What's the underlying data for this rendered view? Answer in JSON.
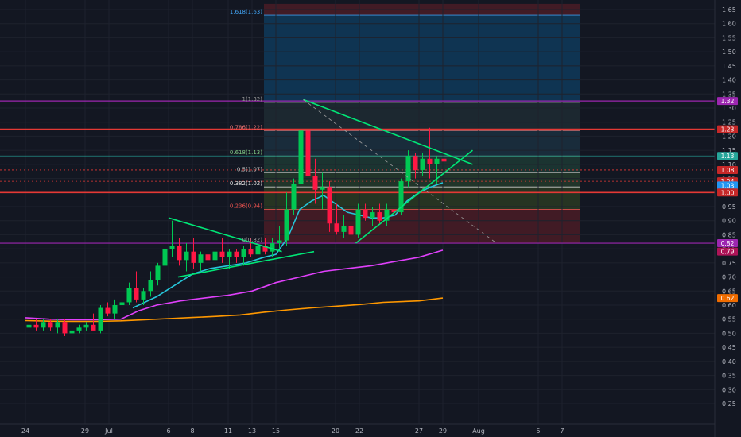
{
  "chart_data": {
    "type": "candlestick",
    "price_axis": {
      "min": 0.2,
      "max": 1.67,
      "ticks": [
        "1.65",
        "1.60",
        "1.55",
        "1.50",
        "1.45",
        "1.40",
        "1.35",
        "1.30",
        "1.25",
        "1.20",
        "1.15",
        "1.10",
        "1.05",
        "1.00",
        "0.95",
        "0.90",
        "0.85",
        "0.80",
        "0.75",
        "0.70",
        "0.65",
        "0.60",
        "0.55",
        "0.50",
        "0.45",
        "0.40",
        "0.35",
        "0.30",
        "0.25"
      ]
    },
    "time_axis": {
      "ticks": [
        {
          "label": "24",
          "day": 0
        },
        {
          "label": "29",
          "day": 5
        },
        {
          "label": "Jul",
          "day": 7
        },
        {
          "label": "6",
          "day": 12
        },
        {
          "label": "8",
          "day": 14
        },
        {
          "label": "11",
          "day": 17
        },
        {
          "label": "13",
          "day": 19
        },
        {
          "label": "15",
          "day": 21
        },
        {
          "label": "20",
          "day": 26
        },
        {
          "label": "22",
          "day": 28
        },
        {
          "label": "27",
          "day": 33
        },
        {
          "label": "29",
          "day": 35
        },
        {
          "label": "Aug",
          "day": 38
        },
        {
          "label": "5",
          "day": 43
        },
        {
          "label": "7",
          "day": 45
        }
      ]
    },
    "price_tags": [
      {
        "label": "1.32",
        "price": 1.325,
        "color": "#9c27b0"
      },
      {
        "label": "1.23",
        "price": 1.225,
        "color": "#c62828"
      },
      {
        "label": "1.13",
        "price": 1.13,
        "color": "#26a69a"
      },
      {
        "label": "1.08",
        "price": 1.08,
        "color": "#c62828"
      },
      {
        "label": "1.04",
        "price": 1.04,
        "color": "#c62828"
      },
      {
        "label": "1.03",
        "price": 1.025,
        "color": "#2196f3"
      },
      {
        "label": "1.00",
        "price": 1.0,
        "color": "#c62828"
      },
      {
        "label": "0.82",
        "price": 0.82,
        "color": "#9c27b0"
      },
      {
        "label": "0.79",
        "price": 0.79,
        "color": "#ad1457"
      },
      {
        "label": "0.62",
        "price": 0.625,
        "color": "#ef6c00"
      }
    ],
    "fib_levels": [
      {
        "label": "1.618(1.63)",
        "price": 1.63,
        "color": "#42a5f5"
      },
      {
        "label": "1(1.32)",
        "price": 1.32,
        "color": "#9e9e9e"
      },
      {
        "label": "0.786(1.22)",
        "price": 1.22,
        "color": "#e57373"
      },
      {
        "label": "0.618(1.13)",
        "price": 1.13,
        "color": "#81c784"
      },
      {
        "label": "0.5(1.07)",
        "price": 1.07,
        "color": "#c0c0c0"
      },
      {
        "label": "0.382(1.02)",
        "price": 1.02,
        "color": "#e0e0e0"
      },
      {
        "label": "0.236(0.94)",
        "price": 0.94,
        "color": "#ef5350"
      },
      {
        "label": "0(0.82)",
        "price": 0.82,
        "color": "#9e9e9e"
      }
    ],
    "candles": [
      {
        "d": 0.3,
        "o": 0.52,
        "h": 0.54,
        "l": 0.51,
        "c": 0.53
      },
      {
        "d": 0.9,
        "o": 0.53,
        "h": 0.55,
        "l": 0.51,
        "c": 0.52
      },
      {
        "d": 1.5,
        "o": 0.52,
        "h": 0.55,
        "l": 0.51,
        "c": 0.54
      },
      {
        "d": 2.1,
        "o": 0.54,
        "h": 0.55,
        "l": 0.51,
        "c": 0.52
      },
      {
        "d": 2.7,
        "o": 0.52,
        "h": 0.55,
        "l": 0.5,
        "c": 0.54
      },
      {
        "d": 3.3,
        "o": 0.54,
        "h": 0.55,
        "l": 0.49,
        "c": 0.5
      },
      {
        "d": 3.9,
        "o": 0.5,
        "h": 0.52,
        "l": 0.49,
        "c": 0.51
      },
      {
        "d": 4.5,
        "o": 0.51,
        "h": 0.53,
        "l": 0.5,
        "c": 0.52
      },
      {
        "d": 5.1,
        "o": 0.52,
        "h": 0.54,
        "l": 0.51,
        "c": 0.53
      },
      {
        "d": 5.7,
        "o": 0.53,
        "h": 0.57,
        "l": 0.52,
        "c": 0.51
      },
      {
        "d": 6.3,
        "o": 0.51,
        "h": 0.6,
        "l": 0.5,
        "c": 0.59
      },
      {
        "d": 6.9,
        "o": 0.59,
        "h": 0.61,
        "l": 0.56,
        "c": 0.57
      },
      {
        "d": 7.5,
        "o": 0.57,
        "h": 0.62,
        "l": 0.55,
        "c": 0.6
      },
      {
        "d": 8.1,
        "o": 0.6,
        "h": 0.65,
        "l": 0.58,
        "c": 0.61
      },
      {
        "d": 8.7,
        "o": 0.61,
        "h": 0.68,
        "l": 0.6,
        "c": 0.66
      },
      {
        "d": 9.3,
        "o": 0.66,
        "h": 0.72,
        "l": 0.61,
        "c": 0.62
      },
      {
        "d": 9.9,
        "o": 0.62,
        "h": 0.66,
        "l": 0.6,
        "c": 0.65
      },
      {
        "d": 10.5,
        "o": 0.65,
        "h": 0.72,
        "l": 0.63,
        "c": 0.69
      },
      {
        "d": 11.1,
        "o": 0.69,
        "h": 0.75,
        "l": 0.67,
        "c": 0.74
      },
      {
        "d": 11.7,
        "o": 0.74,
        "h": 0.83,
        "l": 0.72,
        "c": 0.8
      },
      {
        "d": 12.3,
        "o": 0.8,
        "h": 0.9,
        "l": 0.77,
        "c": 0.81
      },
      {
        "d": 12.9,
        "o": 0.81,
        "h": 0.84,
        "l": 0.74,
        "c": 0.76
      },
      {
        "d": 13.5,
        "o": 0.76,
        "h": 0.82,
        "l": 0.72,
        "c": 0.79
      },
      {
        "d": 14.1,
        "o": 0.79,
        "h": 0.84,
        "l": 0.73,
        "c": 0.75
      },
      {
        "d": 14.7,
        "o": 0.75,
        "h": 0.79,
        "l": 0.72,
        "c": 0.78
      },
      {
        "d": 15.3,
        "o": 0.78,
        "h": 0.8,
        "l": 0.74,
        "c": 0.76
      },
      {
        "d": 15.9,
        "o": 0.76,
        "h": 0.82,
        "l": 0.74,
        "c": 0.79
      },
      {
        "d": 16.5,
        "o": 0.79,
        "h": 0.84,
        "l": 0.75,
        "c": 0.77
      },
      {
        "d": 17.1,
        "o": 0.77,
        "h": 0.8,
        "l": 0.73,
        "c": 0.79
      },
      {
        "d": 17.7,
        "o": 0.79,
        "h": 0.8,
        "l": 0.75,
        "c": 0.77
      },
      {
        "d": 18.3,
        "o": 0.77,
        "h": 0.81,
        "l": 0.74,
        "c": 0.8
      },
      {
        "d": 18.9,
        "o": 0.8,
        "h": 0.84,
        "l": 0.77,
        "c": 0.78
      },
      {
        "d": 19.5,
        "o": 0.78,
        "h": 0.83,
        "l": 0.75,
        "c": 0.81
      },
      {
        "d": 20.1,
        "o": 0.81,
        "h": 0.84,
        "l": 0.78,
        "c": 0.79
      },
      {
        "d": 20.7,
        "o": 0.79,
        "h": 0.84,
        "l": 0.77,
        "c": 0.82
      },
      {
        "d": 21.3,
        "o": 0.82,
        "h": 0.88,
        "l": 0.8,
        "c": 0.83
      },
      {
        "d": 21.9,
        "o": 0.83,
        "h": 1.0,
        "l": 0.81,
        "c": 0.94
      },
      {
        "d": 22.5,
        "o": 0.94,
        "h": 1.05,
        "l": 0.92,
        "c": 1.03
      },
      {
        "d": 23.1,
        "o": 1.03,
        "h": 1.33,
        "l": 0.98,
        "c": 1.22
      },
      {
        "d": 23.7,
        "o": 1.22,
        "h": 1.26,
        "l": 1.02,
        "c": 1.06
      },
      {
        "d": 24.3,
        "o": 1.06,
        "h": 1.12,
        "l": 0.96,
        "c": 1.01
      },
      {
        "d": 24.9,
        "o": 1.01,
        "h": 1.07,
        "l": 0.94,
        "c": 1.02
      },
      {
        "d": 25.5,
        "o": 1.02,
        "h": 1.04,
        "l": 0.86,
        "c": 0.89
      },
      {
        "d": 26.1,
        "o": 0.89,
        "h": 0.96,
        "l": 0.85,
        "c": 0.86
      },
      {
        "d": 26.7,
        "o": 0.86,
        "h": 0.92,
        "l": 0.84,
        "c": 0.88
      },
      {
        "d": 27.3,
        "o": 0.88,
        "h": 0.9,
        "l": 0.82,
        "c": 0.85
      },
      {
        "d": 27.9,
        "o": 0.85,
        "h": 0.96,
        "l": 0.84,
        "c": 0.94
      },
      {
        "d": 28.5,
        "o": 0.94,
        "h": 0.96,
        "l": 0.9,
        "c": 0.91
      },
      {
        "d": 29.1,
        "o": 0.91,
        "h": 0.95,
        "l": 0.88,
        "c": 0.93
      },
      {
        "d": 29.7,
        "o": 0.93,
        "h": 0.96,
        "l": 0.89,
        "c": 0.9
      },
      {
        "d": 30.3,
        "o": 0.9,
        "h": 0.96,
        "l": 0.88,
        "c": 0.94
      },
      {
        "d": 30.9,
        "o": 0.94,
        "h": 0.98,
        "l": 0.9,
        "c": 0.93
      },
      {
        "d": 31.5,
        "o": 0.93,
        "h": 1.05,
        "l": 0.92,
        "c": 1.04
      },
      {
        "d": 32.1,
        "o": 1.04,
        "h": 1.15,
        "l": 1.02,
        "c": 1.13
      },
      {
        "d": 32.7,
        "o": 1.13,
        "h": 1.14,
        "l": 1.05,
        "c": 1.08
      },
      {
        "d": 33.3,
        "o": 1.08,
        "h": 1.14,
        "l": 1.06,
        "c": 1.12
      },
      {
        "d": 33.9,
        "o": 1.12,
        "h": 1.23,
        "l": 1.05,
        "c": 1.1
      },
      {
        "d": 34.5,
        "o": 1.1,
        "h": 1.13,
        "l": 1.03,
        "c": 1.12
      },
      {
        "d": 35.1,
        "o": 1.12,
        "h": 1.13,
        "l": 1.1,
        "c": 1.11
      }
    ],
    "moving_averages": [
      {
        "name": "",
        "color": "#26c6da",
        "points": [
          [
            9.0,
            0.59
          ],
          [
            11.0,
            0.63
          ],
          [
            12.5,
            0.67
          ],
          [
            14.0,
            0.71
          ],
          [
            15.5,
            0.73
          ],
          [
            17.0,
            0.74
          ],
          [
            18.5,
            0.75
          ],
          [
            20.0,
            0.77
          ],
          [
            21.0,
            0.78
          ],
          [
            22.0,
            0.84
          ],
          [
            23.0,
            0.94
          ],
          [
            24.0,
            0.97
          ],
          [
            25.0,
            0.99
          ],
          [
            26.0,
            0.96
          ],
          [
            27.0,
            0.93
          ],
          [
            28.0,
            0.92
          ],
          [
            29.0,
            0.91
          ],
          [
            30.0,
            0.91
          ],
          [
            31.0,
            0.92
          ],
          [
            32.0,
            0.97
          ],
          [
            33.0,
            1.0
          ],
          [
            34.0,
            1.02
          ],
          [
            35.0,
            1.035
          ]
        ]
      },
      {
        "name": "",
        "color": "#e040fb",
        "points": [
          [
            0.0,
            0.555
          ],
          [
            2.0,
            0.55
          ],
          [
            4.0,
            0.548
          ],
          [
            6.0,
            0.548
          ],
          [
            8.0,
            0.55
          ],
          [
            9.5,
            0.58
          ],
          [
            11.0,
            0.6
          ],
          [
            13.0,
            0.615
          ],
          [
            15.0,
            0.625
          ],
          [
            17.0,
            0.635
          ],
          [
            19.0,
            0.65
          ],
          [
            21.0,
            0.68
          ],
          [
            23.0,
            0.7
          ],
          [
            25.0,
            0.72
          ],
          [
            27.0,
            0.73
          ],
          [
            29.0,
            0.74
          ],
          [
            31.0,
            0.755
          ],
          [
            33.0,
            0.77
          ],
          [
            35.0,
            0.795
          ]
        ]
      },
      {
        "name": "",
        "color": "#ff9800",
        "points": [
          [
            0.0,
            0.545
          ],
          [
            2.0,
            0.543
          ],
          [
            4.0,
            0.542
          ],
          [
            6.0,
            0.542
          ],
          [
            8.0,
            0.544
          ],
          [
            10.0,
            0.548
          ],
          [
            12.0,
            0.552
          ],
          [
            14.0,
            0.556
          ],
          [
            16.0,
            0.56
          ],
          [
            18.0,
            0.565
          ],
          [
            20.0,
            0.575
          ],
          [
            22.0,
            0.583
          ],
          [
            24.0,
            0.59
          ],
          [
            26.0,
            0.596
          ],
          [
            28.0,
            0.602
          ],
          [
            30.0,
            0.61
          ],
          [
            33.0,
            0.615
          ],
          [
            35.0,
            0.625
          ]
        ]
      }
    ],
    "trendlines": [
      {
        "color": "#00e676",
        "from": [
          12.0,
          0.91
        ],
        "to": [
          21.5,
          0.79
        ]
      },
      {
        "color": "#00e676",
        "from": [
          12.8,
          0.7
        ],
        "to": [
          24.2,
          0.79
        ]
      },
      {
        "color": "#00e676",
        "from": [
          23.3,
          1.33
        ],
        "to": [
          37.5,
          1.1
        ]
      },
      {
        "color": "#00e676",
        "from": [
          27.7,
          0.82
        ],
        "to": [
          37.5,
          1.15
        ]
      },
      {
        "color": "#9e9e9e",
        "from": [
          23.3,
          1.33
        ],
        "to": [
          39.5,
          0.82
        ],
        "dashed": true
      }
    ]
  }
}
